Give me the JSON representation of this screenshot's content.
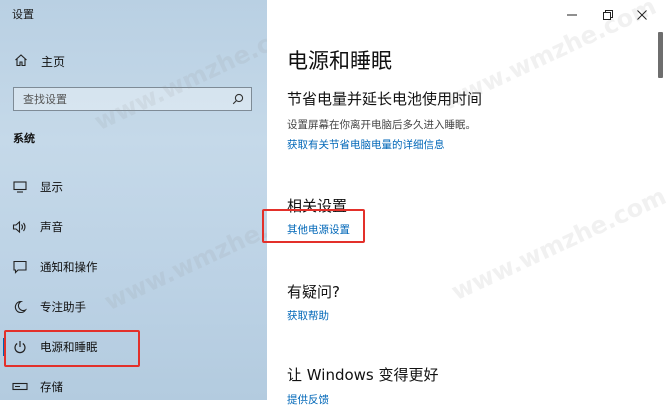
{
  "window": {
    "title": "设置"
  },
  "sidebar": {
    "home_label": "主页",
    "search_placeholder": "查找设置",
    "section": "系统",
    "items": [
      {
        "label": "显示",
        "icon": "display-icon"
      },
      {
        "label": "声音",
        "icon": "speaker-icon"
      },
      {
        "label": "通知和操作",
        "icon": "notification-icon"
      },
      {
        "label": "专注助手",
        "icon": "moon-icon"
      },
      {
        "label": "电源和睡眠",
        "icon": "power-icon",
        "selected": true
      },
      {
        "label": "存储",
        "icon": "storage-icon"
      }
    ]
  },
  "main": {
    "title": "电源和睡眠",
    "battery_heading": "节省电量并延长电池使用时间",
    "battery_desc": "设置屏幕在你离开电脑后多久进入睡眠。",
    "battery_link": "获取有关节省电脑电量的详细信息",
    "related_heading": "相关设置",
    "related_link": "其他电源设置",
    "help_heading": "有疑问?",
    "help_link": "获取帮助",
    "feedback_heading": "让 Windows 变得更好",
    "feedback_link": "提供反馈"
  },
  "watermark": "www.wmzhe.com",
  "colors": {
    "accent": "#0063b1",
    "link": "#0067b8",
    "highlight": "#e3302a"
  }
}
